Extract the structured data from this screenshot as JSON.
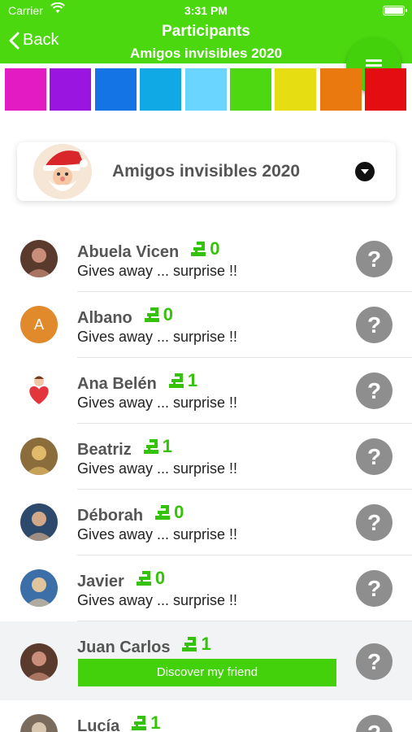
{
  "status_bar": {
    "carrier": "Carrier",
    "time": "3:31 PM"
  },
  "nav": {
    "back_label": "Back",
    "title": "Participants",
    "subtitle": "Amigos invisibles 2020"
  },
  "colors": {
    "accent": "#4bd80f",
    "swatches": [
      "#e21bc2",
      "#9a15e0",
      "#1474e6",
      "#11a8e6",
      "#6ad6ff",
      "#4ed811",
      "#e6dd13",
      "#ea7a0f",
      "#e40d12"
    ]
  },
  "project": {
    "name": "Amigos invisibles 2020"
  },
  "participants": [
    {
      "name": "Abuela Vicen",
      "gifts": "0",
      "desc": "Gives away ... surprise !!",
      "avatar": "photo"
    },
    {
      "name": "Albano",
      "gifts": "0",
      "desc": "Gives away ... surprise !!",
      "avatar": "letter",
      "initial": "A"
    },
    {
      "name": "Ana Belén",
      "gifts": "1",
      "desc": "Gives away ... surprise !!",
      "avatar": "heart"
    },
    {
      "name": "Beatriz",
      "gifts": "1",
      "desc": "Gives away ... surprise !!",
      "avatar": "photo"
    },
    {
      "name": "Déborah",
      "gifts": "0",
      "desc": "Gives away ... surprise !!",
      "avatar": "photo"
    },
    {
      "name": "Javier",
      "gifts": "0",
      "desc": "Gives away ... surprise !!",
      "avatar": "photo"
    },
    {
      "name": "Juan Carlos",
      "gifts": "1",
      "action": "Discover my friend",
      "avatar": "photo",
      "highlight": true
    },
    {
      "name": "Lucía",
      "gifts": "1",
      "desc": "",
      "avatar": "photo"
    }
  ],
  "help_symbol": "?"
}
